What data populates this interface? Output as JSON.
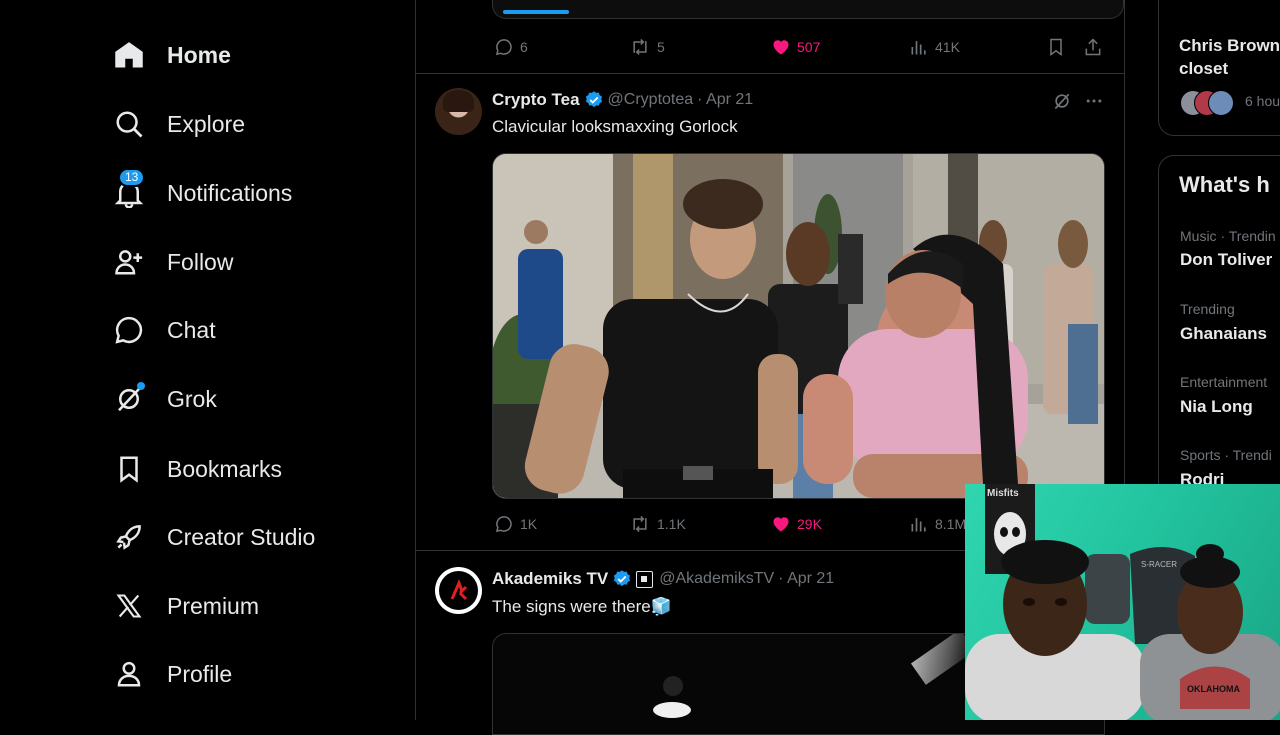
{
  "nav": {
    "items": [
      {
        "label": "Home",
        "icon": "home-icon"
      },
      {
        "label": "Explore",
        "icon": "search-icon"
      },
      {
        "label": "Notifications",
        "icon": "bell-icon",
        "badge": "13"
      },
      {
        "label": "Follow",
        "icon": "person-add-icon"
      },
      {
        "label": "Chat",
        "icon": "chat-icon"
      },
      {
        "label": "Grok",
        "icon": "grok-icon"
      },
      {
        "label": "Bookmarks",
        "icon": "bookmark-icon"
      },
      {
        "label": "Creator Studio",
        "icon": "rocket-icon"
      },
      {
        "label": "Premium",
        "icon": "x-logo-icon"
      },
      {
        "label": "Profile",
        "icon": "person-icon"
      }
    ]
  },
  "feed": {
    "top_actions": {
      "replies": "6",
      "reposts": "5",
      "likes": "507",
      "views": "41K"
    },
    "tweet1": {
      "name": "Crypto Tea",
      "handle": "@Cryptotea",
      "date": "· Apr 21",
      "text": "Clavicular looksmaxxing Gorlock",
      "media": "photo-street-scene",
      "actions": {
        "replies": "1K",
        "reposts": "1.1K",
        "likes": "29K",
        "views": "8.1M"
      }
    },
    "tweet2": {
      "name": "Akademiks TV",
      "handle": "@AkademiksTV",
      "date": "· Apr 21",
      "text": "The signs were there🧊"
    }
  },
  "sidebar": {
    "news": {
      "title_line1": "Chris Brown",
      "title_line2": "closet",
      "time": "6 hou"
    },
    "trends": {
      "heading": "What's h",
      "items": [
        {
          "category": "Music · Trendin",
          "name": "Don Toliver"
        },
        {
          "category": "Trending",
          "name": "Ghanaians"
        },
        {
          "category": "Entertainment",
          "name": "Nia Long"
        },
        {
          "category": "Sports · Trendi",
          "name": "Rodri"
        }
      ]
    }
  },
  "webcam": {
    "poster_text": "Misfits",
    "chair_text": "S-RACER",
    "shirt_text": "OKLAHOMA"
  },
  "colors": {
    "like": "#f91880",
    "verified": "#1d9bf0",
    "accent": "#1d9bf0",
    "muted": "#71767b"
  }
}
